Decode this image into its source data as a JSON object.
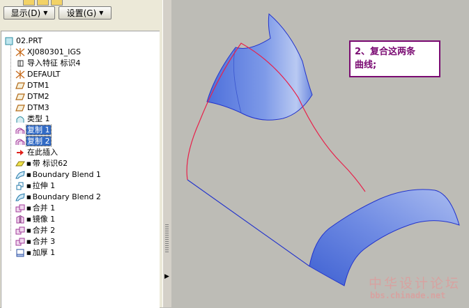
{
  "toolbar": {
    "show_label": "显示",
    "show_key": "(D)",
    "settings_label": "设置",
    "settings_key": "(G)"
  },
  "tree": {
    "items": [
      {
        "label": "02.PRT",
        "icon": "part-icon"
      },
      {
        "label": "XJ080301_IGS",
        "icon": "coordinate-system-icon"
      },
      {
        "label": "导入特征 标识4",
        "icon": "import-feature-icon"
      },
      {
        "label": "DEFAULT",
        "icon": "coordinate-system-icon"
      },
      {
        "label": "DTM1",
        "icon": "datum-plane-icon"
      },
      {
        "label": "DTM2",
        "icon": "datum-plane-icon"
      },
      {
        "label": "DTM3",
        "icon": "datum-plane-icon"
      },
      {
        "label": "类型 1",
        "icon": "surface-icon"
      },
      {
        "label": "复制 1",
        "icon": "copy-surface-icon",
        "selected": true
      },
      {
        "label": "复制 2",
        "icon": "copy-surface-icon",
        "selected": true
      },
      {
        "label": "在此插入",
        "icon": "insert-here-arrow-icon"
      },
      {
        "label": "带 标识62",
        "icon": "ribbon-icon"
      },
      {
        "label": "Boundary Blend 1",
        "icon": "boundary-blend-icon"
      },
      {
        "label": "拉伸 1",
        "icon": "extrude-icon"
      },
      {
        "label": "Boundary Blend 2",
        "icon": "boundary-blend-icon"
      },
      {
        "label": "合并 1",
        "icon": "merge-icon"
      },
      {
        "label": "镜像 1",
        "icon": "mirror-icon"
      },
      {
        "label": "合并 2",
        "icon": "merge-icon"
      },
      {
        "label": "合并 3",
        "icon": "merge-icon"
      },
      {
        "label": "加厚 1",
        "icon": "thicken-icon"
      }
    ]
  },
  "note": {
    "line1": "2、复合这两条",
    "line2": "曲线;"
  },
  "watermark": {
    "title": "中华设计论坛",
    "url": "bbs.chinade.net"
  },
  "colors": {
    "surface": "#6a86e0",
    "curve": "#e8204a",
    "edge": "#2233cc",
    "note_border": "#7a0a72",
    "selection": "#316ac5"
  }
}
